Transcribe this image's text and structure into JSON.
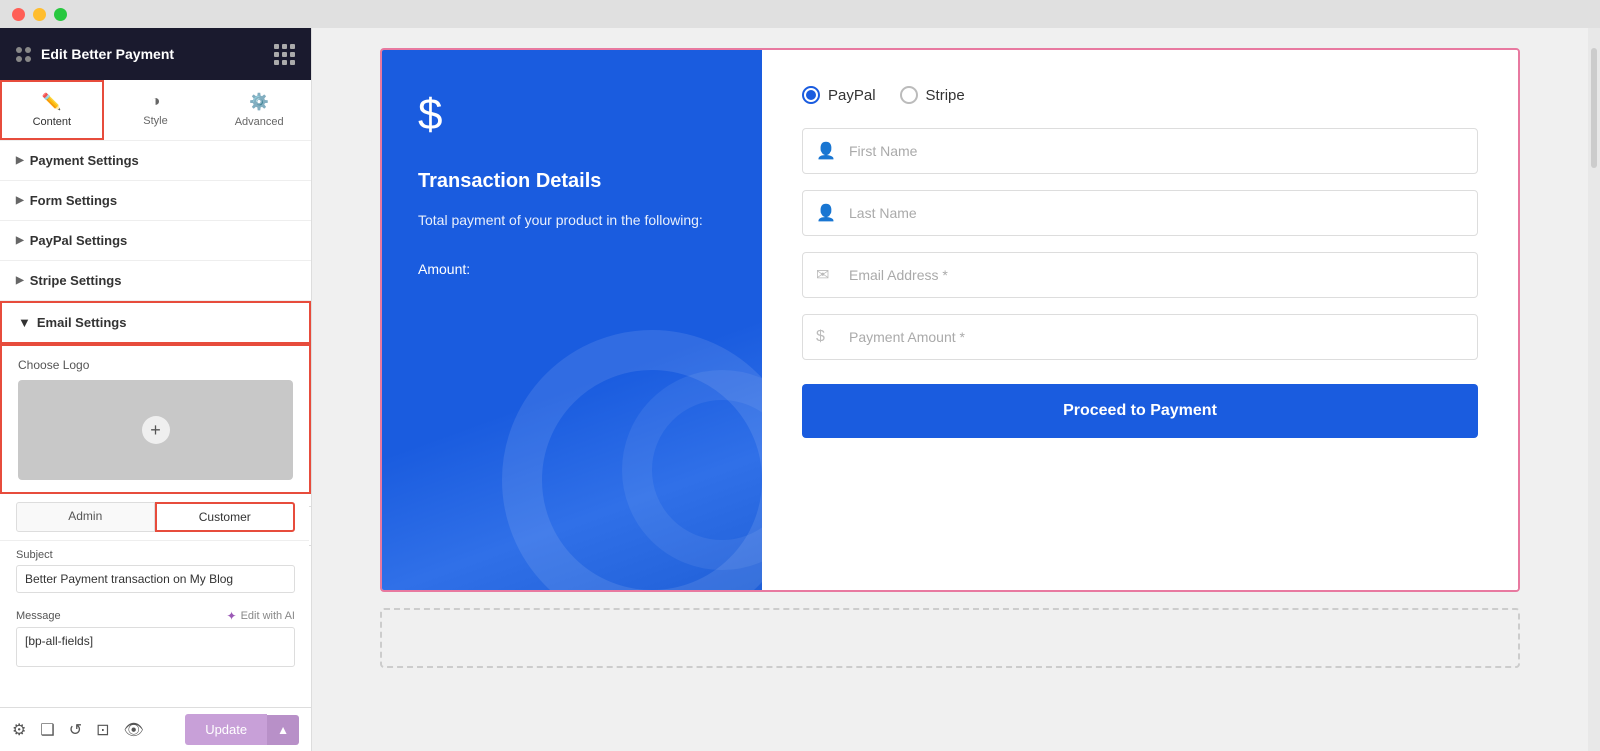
{
  "titlebar": {
    "buttons": [
      "close",
      "minimize",
      "maximize"
    ]
  },
  "sidebar": {
    "header": {
      "title": "Edit Better Payment",
      "dots_label": "menu-dots",
      "grid_label": "grid-icon"
    },
    "tabs": [
      {
        "id": "content",
        "label": "Content",
        "icon": "✏️",
        "active": true
      },
      {
        "id": "style",
        "label": "Style",
        "icon": "◑"
      },
      {
        "id": "advanced",
        "label": "Advanced",
        "icon": "⚙️"
      }
    ],
    "sections": [
      {
        "id": "payment-settings",
        "label": "Payment Settings",
        "expanded": false
      },
      {
        "id": "form-settings",
        "label": "Form Settings",
        "expanded": false
      },
      {
        "id": "paypal-settings",
        "label": "PayPal Settings",
        "expanded": false
      },
      {
        "id": "stripe-settings",
        "label": "Stripe Settings",
        "expanded": false
      },
      {
        "id": "email-settings",
        "label": "Email Settings",
        "expanded": true,
        "active": true
      }
    ],
    "email_settings": {
      "choose_logo_label": "Choose Logo",
      "upload_plus": "+",
      "admin_tab": "Admin",
      "customer_tab": "Customer",
      "subject_label": "Subject",
      "subject_value": "Better Payment transaction on My Blog",
      "message_label": "Message",
      "edit_ai_label": "Edit with AI",
      "message_placeholder": "[bp-all-fields]"
    }
  },
  "bottom_toolbar": {
    "update_label": "Update",
    "icons": [
      "gear",
      "layers",
      "history",
      "copy",
      "eye"
    ]
  },
  "main": {
    "widget": {
      "left_panel": {
        "dollar_sign": "$",
        "title": "Transaction Details",
        "description": "Total payment of your product in the following:",
        "amount_label": "Amount:"
      },
      "right_panel": {
        "payment_options": [
          {
            "id": "paypal",
            "label": "PayPal",
            "selected": true
          },
          {
            "id": "stripe",
            "label": "Stripe",
            "selected": false
          }
        ],
        "fields": [
          {
            "id": "first_name",
            "placeholder": "First Name",
            "icon": "person"
          },
          {
            "id": "last_name",
            "placeholder": "Last Name",
            "icon": "person"
          },
          {
            "id": "email",
            "placeholder": "Email Address *",
            "icon": "email"
          },
          {
            "id": "payment_amount",
            "placeholder": "Payment Amount *",
            "icon": "dollar"
          }
        ],
        "proceed_button": "Proceed to Payment"
      }
    }
  }
}
